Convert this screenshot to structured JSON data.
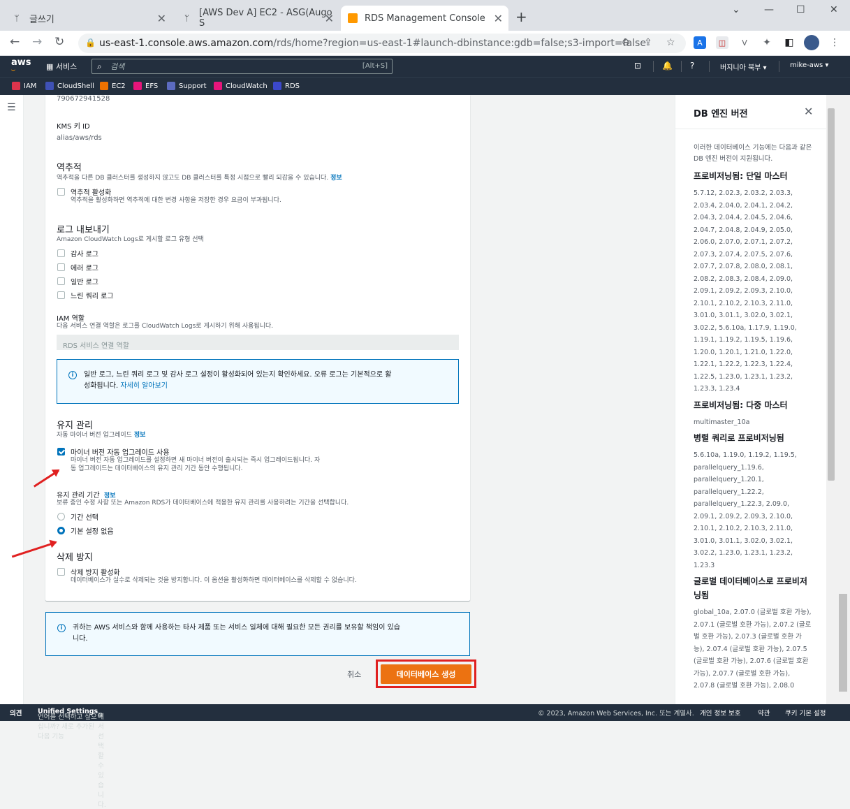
{
  "browser": {
    "tabs": [
      {
        "title": "글쓰기",
        "icon": "trident-icon"
      },
      {
        "title": "[AWS Dev A] EC2 - ASG(Augo S",
        "icon": "trident-icon"
      },
      {
        "title": "RDS Management Console",
        "icon": "aws-cube-icon"
      }
    ],
    "url_domain": "us-east-1.console.aws.amazon.com",
    "url_path": "/rds/home?region=us-east-1#launch-dbinstance:gdb=false;s3-import=false"
  },
  "aws_header": {
    "logo": "aws",
    "services_label": "서비스",
    "search_placeholder": "검색",
    "search_shortcut": "[Alt+S]",
    "region": "버지니아 북부 ▾",
    "account": "mike-aws ▾"
  },
  "favorites": [
    "IAM",
    "CloudShell",
    "EC2",
    "EFS",
    "Support",
    "CloudWatch",
    "RDS"
  ],
  "favorite_colors": [
    "#dd344c",
    "#3f51b5",
    "#ed7100",
    "#e7157b",
    "#5c6bc0",
    "#e7157b",
    "#3b48cc"
  ],
  "form": {
    "account_value": "790672941528",
    "kms_label": "KMS 키 ID",
    "kms_value": "alias/aws/rds",
    "backtrack_title": "역추적",
    "backtrack_desc": "역추적을 다른 DB 클러스터를 생성하지 않고도 DB 클러스터를 특정 시점으로 빨리 되감을 수 있습니다.",
    "info": "정보",
    "backtrack_enable": "역추적 활성화",
    "backtrack_enable_desc": "역추적을 활성화하면 역추적에 대한 변경 사항을 저장한 경우 요금이 부과됩니다.",
    "log_title": "로그 내보내기",
    "log_desc": "Amazon CloudWatch Logs로 게시할 로그 유형 선택",
    "logs": [
      "감사 로그",
      "에러 로그",
      "일반 로그",
      "느린 쿼리 로그"
    ],
    "iam_title": "IAM 역할",
    "iam_desc": "다음 서비스 연결 역할은 로그를 CloudWatch Logs로 게시하기 위해 사용됩니다.",
    "iam_value": "RDS 서비스 연결 역할",
    "info_box_text": "일반 로그, 느린 쿼리 로그 및 감사 로그 설정이 활성화되어 있는지 확인하세요. 오류 로그는 기본적으로 활",
    "info_box_text2": "성화됩니다.",
    "info_box_link": "자세히 알아보기",
    "maint_title": "유지 관리",
    "maint_desc": "자동 마이너 버전 업그레이드",
    "auto_minor": "마이너 버전 자동 업그레이드 사용",
    "auto_minor_desc1": "마이너 버전 자동 업그레이드를 설정하면 새 마이너 버전이 출시되는 즉시 업그레이드됩니다. 자",
    "auto_minor_desc2": "동 업그레이드는 데이터베이스의 유지 관리 기간 동안 수행됩니다.",
    "window_title": "유지 관리 기간",
    "window_desc": "보류 중인 수정 사항 또는 Amazon RDS가 데이터베이스에 적용한 유지 관리를 사용하려는 기간을 선택합니다.",
    "window_opt1": "기간 선택",
    "window_opt2": "기본 설정 없음",
    "delprot_title": "삭제 방지",
    "delprot_enable": "삭제 방지 활성화",
    "delprot_desc": "데이터베이스가 실수로 삭제되는 것을 방지합니다. 이 옵션을 활성화하면 데이터베이스를 삭제할 수 없습니다."
  },
  "bottom_notice1": "귀하는 AWS 서비스와 함께 사용하는 타사 제품 또는 서비스 일체에 대해 필요한 모든 권리를 보유할 책임이 있습",
  "bottom_notice2": "니다.",
  "actions": {
    "cancel": "취소",
    "create": "데이터베이스 생성"
  },
  "help": {
    "title": "DB 엔진 버전",
    "intro": "이러한 데이터베이스 기능에는 다음과 같은 DB 엔진 버전이 지원됩니다.",
    "sections": [
      {
        "title": "프로비저닝됨: 단일 마스터",
        "text": "5.7.12, 2.02.3, 2.03.2, 2.03.3, 2.03.4, 2.04.0, 2.04.1, 2.04.2, 2.04.3, 2.04.4, 2.04.5, 2.04.6, 2.04.7, 2.04.8, 2.04.9, 2.05.0, 2.06.0, 2.07.0, 2.07.1, 2.07.2, 2.07.3, 2.07.4, 2.07.5, 2.07.6, 2.07.7, 2.07.8, 2.08.0, 2.08.1, 2.08.2, 2.08.3, 2.08.4, 2.09.0, 2.09.1, 2.09.2, 2.09.3, 2.10.0, 2.10.1, 2.10.2, 2.10.3, 2.11.0, 3.01.0, 3.01.1, 3.02.0, 3.02.1, 3.02.2, 5.6.10a, 1.17.9, 1.19.0, 1.19.1, 1.19.2, 1.19.5, 1.19.6, 1.20.0, 1.20.1, 1.21.0, 1.22.0, 1.22.1, 1.22.2, 1.22.3, 1.22.4, 1.22.5, 1.23.0, 1.23.1, 1.23.2, 1.23.3, 1.23.4"
      },
      {
        "title": "프로비저닝됨: 다중 마스터",
        "text": "multimaster_10a"
      },
      {
        "title": "병렬 쿼리로 프로비저닝됨",
        "text": "5.6.10a, 1.19.0, 1.19.2, 1.19.5, parallelquery_1.19.6, parallelquery_1.20.1, parallelquery_1.22.2, parallelquery_1.22.3, 2.09.0, 2.09.1, 2.09.2, 2.09.3, 2.10.0, 2.10.1, 2.10.2, 2.10.3, 2.11.0, 3.01.0, 3.01.1, 3.02.0, 3.02.1, 3.02.2, 1.23.0, 1.23.1, 1.23.2, 1.23.3"
      },
      {
        "title": "글로벌 데이터베이스로 프로비저닝됨",
        "text": "global_10a, 2.07.0 (글로벌 호환 가능), 2.07.1 (글로벌 호환 가능), 2.07.2 (글로벌 호환 가능), 2.07.3 (글로벌 호환 가능), 2.07.4 (글로벌 호환 가능), 2.07.5 (글로벌 호환 가능), 2.07.6 (글로벌 호환 가능), 2.07.7 (글로벌 호환 가능), 2.07.8 (글로벌 호환 가능), 2.08.0"
      }
    ]
  },
  "footer": {
    "feedback": "의견",
    "lang_prompt": "언어를 선택하고 싶으십니까? 새로 추가된 다음 기능",
    "unified": "Unified Settings",
    "lang_suffix": "에서 선택할 수 있습니다.",
    "copyright": "© 2023, Amazon Web Services, Inc. 또는 계열사.",
    "privacy": "개인 정보 보호",
    "terms": "약관",
    "cookies": "쿠키 기본 설정"
  },
  "colors": {
    "aws_dark": "#232f3e",
    "primary_orange": "#ec7211",
    "link_blue": "#0073bb",
    "highlight_red": "#e02020"
  }
}
